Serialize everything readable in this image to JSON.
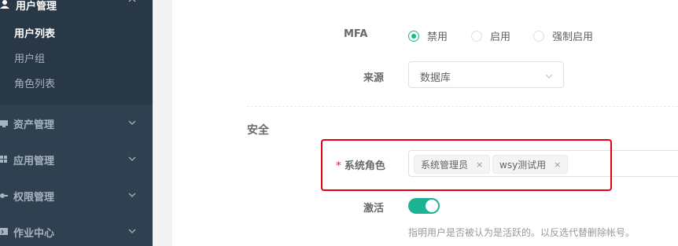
{
  "sidebar": {
    "group": {
      "label": "用户管理",
      "items": [
        {
          "label": "用户列表",
          "active": true
        },
        {
          "label": "用户组",
          "active": false
        },
        {
          "label": "角色列表",
          "active": false
        }
      ]
    },
    "nav": [
      {
        "label": "资产管理",
        "icon": "monitor-icon"
      },
      {
        "label": "应用管理",
        "icon": "apps-grid-icon"
      },
      {
        "label": "权限管理",
        "icon": "key-icon"
      },
      {
        "label": "作业中心",
        "icon": "terminal-icon"
      }
    ]
  },
  "form": {
    "mfa": {
      "label": "MFA",
      "options": [
        {
          "label": "禁用",
          "checked": true
        },
        {
          "label": "启用",
          "checked": false
        },
        {
          "label": "强制启用",
          "checked": false
        }
      ]
    },
    "source": {
      "label": "来源",
      "value": "数据库"
    },
    "security_section": "安全",
    "system_role": {
      "required_mark": "*",
      "label": "系统角色",
      "tags": [
        "系统管理员",
        "wsy测试用"
      ],
      "tag_close": "×"
    },
    "active": {
      "label": "激活",
      "on": true,
      "help": "指明用户是否被认为是活跃的。以反选代替删除帐号。"
    }
  },
  "colors": {
    "accent": "#1ab394",
    "highlight_box": "#e60012",
    "sidebar": "#2f4050"
  }
}
